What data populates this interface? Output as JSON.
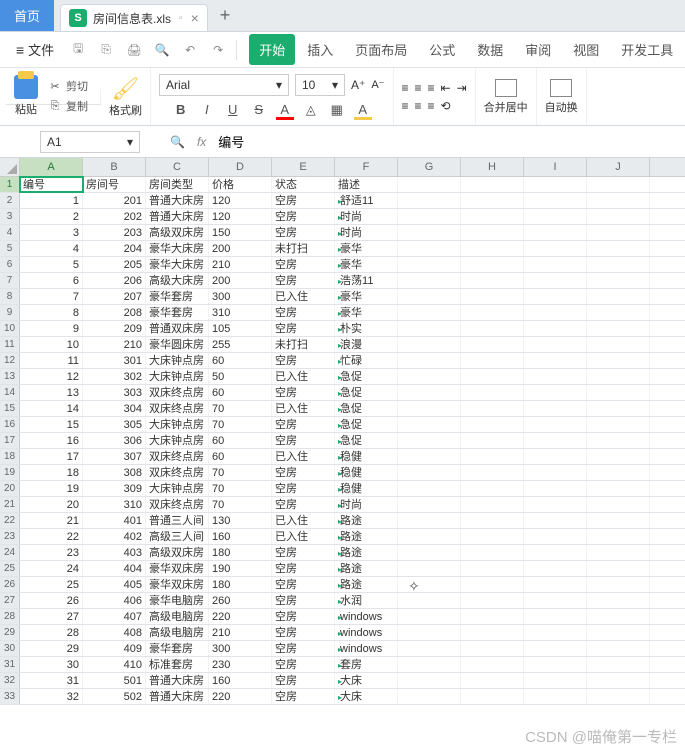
{
  "tabs": {
    "home": "首页",
    "filename": "房间信息表.xls",
    "xls_badge": "S"
  },
  "menubar": {
    "file": "文件"
  },
  "menu": [
    "开始",
    "插入",
    "页面布局",
    "公式",
    "数据",
    "审阅",
    "视图",
    "开发工具"
  ],
  "ribbon": {
    "paste": "粘贴",
    "cut": "剪切",
    "copy": "复制",
    "brush": "格式刷",
    "font": "Arial",
    "size": "10",
    "merge": "合并居中",
    "wrap": "自动换"
  },
  "namebox": "A1",
  "formula": "编号",
  "cols": [
    "A",
    "B",
    "C",
    "D",
    "E",
    "F",
    "G",
    "H",
    "I",
    "J"
  ],
  "headers": [
    "编号",
    "房间号",
    "房间类型",
    "价格",
    "状态",
    "描述"
  ],
  "rows": [
    {
      "n": 1,
      "id": 1,
      "room": 201,
      "type": "普通大床房",
      "price": 120,
      "status": "空房",
      "desc": "舒适11"
    },
    {
      "n": 2,
      "id": 2,
      "room": 202,
      "type": "普通大床房",
      "price": 120,
      "status": "空房",
      "desc": "时尚"
    },
    {
      "n": 3,
      "id": 3,
      "room": 203,
      "type": "高级双床房",
      "price": 150,
      "status": "空房",
      "desc": "时尚"
    },
    {
      "n": 4,
      "id": 4,
      "room": 204,
      "type": "豪华大床房",
      "price": 200,
      "status": "未打扫",
      "desc": "豪华"
    },
    {
      "n": 5,
      "id": 5,
      "room": 205,
      "type": "豪华大床房",
      "price": 210,
      "status": "空房",
      "desc": "豪华"
    },
    {
      "n": 6,
      "id": 6,
      "room": 206,
      "type": "高级大床房",
      "price": 200,
      "status": "空房",
      "desc": "浩荡11"
    },
    {
      "n": 7,
      "id": 7,
      "room": 207,
      "type": "豪华套房",
      "price": 300,
      "status": "已入住",
      "desc": "豪华"
    },
    {
      "n": 8,
      "id": 8,
      "room": 208,
      "type": "豪华套房",
      "price": 310,
      "status": "空房",
      "desc": "豪华"
    },
    {
      "n": 9,
      "id": 9,
      "room": 209,
      "type": "普通双床房",
      "price": 105,
      "status": "空房",
      "desc": "朴实"
    },
    {
      "n": 10,
      "id": 10,
      "room": 210,
      "type": "豪华圆床房",
      "price": 255,
      "status": "未打扫",
      "desc": "浪漫"
    },
    {
      "n": 11,
      "id": 11,
      "room": 301,
      "type": "大床钟点房",
      "price": 60,
      "status": "空房",
      "desc": "忙碌"
    },
    {
      "n": 12,
      "id": 12,
      "room": 302,
      "type": "大床钟点房",
      "price": 50,
      "status": "已入住",
      "desc": "急促"
    },
    {
      "n": 13,
      "id": 13,
      "room": 303,
      "type": "双床终点房",
      "price": 60,
      "status": "空房",
      "desc": "急促"
    },
    {
      "n": 14,
      "id": 14,
      "room": 304,
      "type": "双床终点房",
      "price": 70,
      "status": "已入住",
      "desc": "急促"
    },
    {
      "n": 15,
      "id": 15,
      "room": 305,
      "type": "大床钟点房",
      "price": 70,
      "status": "空房",
      "desc": "急促"
    },
    {
      "n": 16,
      "id": 16,
      "room": 306,
      "type": "大床钟点房",
      "price": 60,
      "status": "空房",
      "desc": "急促"
    },
    {
      "n": 17,
      "id": 17,
      "room": 307,
      "type": "双床终点房",
      "price": 60,
      "status": "已入住",
      "desc": "稳健"
    },
    {
      "n": 18,
      "id": 18,
      "room": 308,
      "type": "双床终点房",
      "price": 70,
      "status": "空房",
      "desc": "稳健"
    },
    {
      "n": 19,
      "id": 19,
      "room": 309,
      "type": "大床钟点房",
      "price": 70,
      "status": "空房",
      "desc": "稳健"
    },
    {
      "n": 20,
      "id": 20,
      "room": 310,
      "type": "双床终点房",
      "price": 70,
      "status": "空房",
      "desc": "时尚"
    },
    {
      "n": 21,
      "id": 21,
      "room": 401,
      "type": "普通三人间",
      "price": 130,
      "status": "已入住",
      "desc": "路途"
    },
    {
      "n": 22,
      "id": 22,
      "room": 402,
      "type": "高级三人间",
      "price": 160,
      "status": "已入住",
      "desc": "路途"
    },
    {
      "n": 23,
      "id": 23,
      "room": 403,
      "type": "高级双床房",
      "price": 180,
      "status": "空房",
      "desc": "路途"
    },
    {
      "n": 24,
      "id": 24,
      "room": 404,
      "type": "豪华双床房",
      "price": 190,
      "status": "空房",
      "desc": "路途"
    },
    {
      "n": 25,
      "id": 25,
      "room": 405,
      "type": "豪华双床房",
      "price": 180,
      "status": "空房",
      "desc": "路途"
    },
    {
      "n": 26,
      "id": 26,
      "room": 406,
      "type": "豪华电脑房",
      "price": 260,
      "status": "空房",
      "desc": "水润"
    },
    {
      "n": 27,
      "id": 27,
      "room": 407,
      "type": "高级电脑房",
      "price": 220,
      "status": "空房",
      "desc": "windows"
    },
    {
      "n": 28,
      "id": 28,
      "room": 408,
      "type": "高级电脑房",
      "price": 210,
      "status": "空房",
      "desc": "windows"
    },
    {
      "n": 29,
      "id": 29,
      "room": 409,
      "type": "豪华套房",
      "price": 300,
      "status": "空房",
      "desc": "windows"
    },
    {
      "n": 30,
      "id": 30,
      "room": 410,
      "type": "标准套房",
      "price": 230,
      "status": "空房",
      "desc": "套房"
    },
    {
      "n": 31,
      "id": 31,
      "room": 501,
      "type": "普通大床房",
      "price": 160,
      "status": "空房",
      "desc": "大床"
    },
    {
      "n": 32,
      "id": 32,
      "room": 502,
      "type": "普通大床房",
      "price": 220,
      "status": "空房",
      "desc": "大床"
    }
  ],
  "watermark": "CSDN @喵俺第一专栏"
}
